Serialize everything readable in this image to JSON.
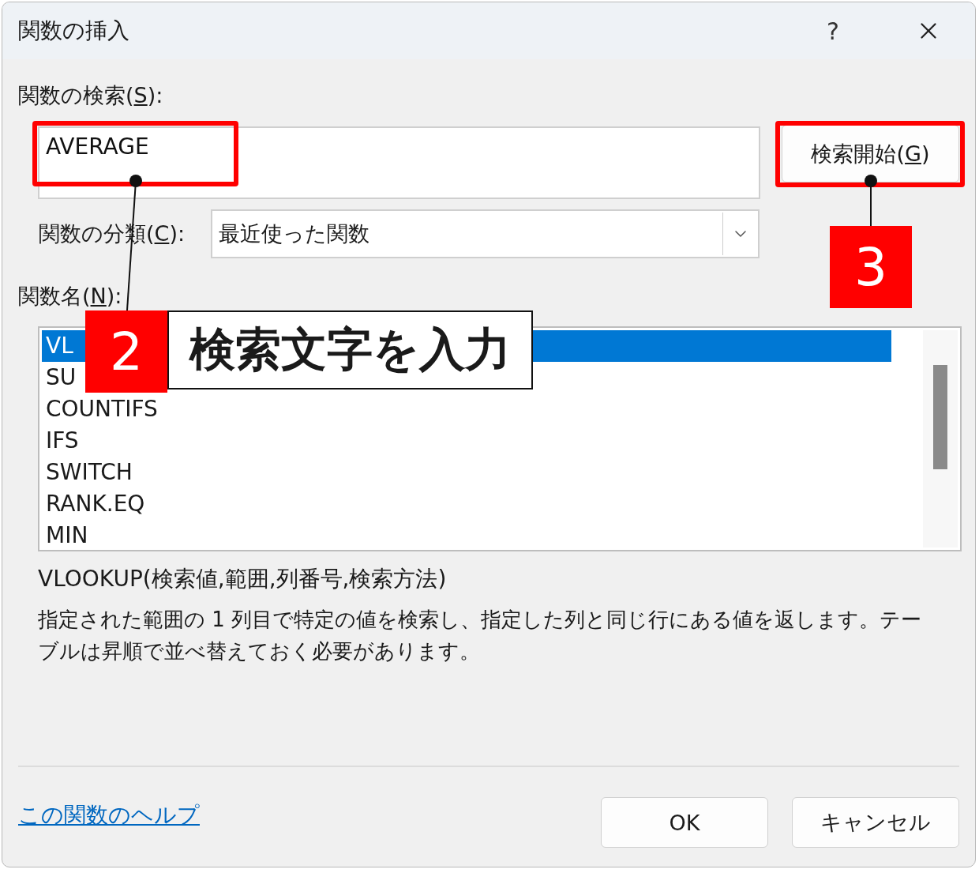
{
  "window": {
    "title": "関数の挿入",
    "help": "?"
  },
  "search": {
    "label": {
      "before": "関数の検索(",
      "key": "S",
      "after": "):"
    },
    "value": "AVERAGE",
    "highlighted": true
  },
  "search_button": {
    "label": {
      "before": "検索開始(",
      "key": "G",
      "after": ")"
    },
    "highlighted": true
  },
  "category": {
    "label": {
      "before": "関数の分類(",
      "key": "C",
      "after": "):"
    },
    "value": "最近使った関数"
  },
  "function_list": {
    "label": {
      "before": "関数名(",
      "key": "N",
      "after": "):"
    },
    "items": [
      {
        "name": "VL",
        "selected": true
      },
      {
        "name": "SU",
        "selected": false
      },
      {
        "name": "COUNTIFS",
        "selected": false
      },
      {
        "name": "IFS",
        "selected": false
      },
      {
        "name": "SWITCH",
        "selected": false
      },
      {
        "name": "RANK.EQ",
        "selected": false
      },
      {
        "name": "MIN",
        "selected": false
      }
    ]
  },
  "syntax": "VLOOKUP(検索値,範囲,列番号,検索方法)",
  "description": "指定された範囲の 1 列目で特定の値を検索し、指定した列と同じ行にある値を返します。テーブルは昇順で並べ替えておく必要があります。",
  "help_link": "この関数のヘルプ",
  "buttons": [
    "OK",
    "キャンセル"
  ],
  "callouts": [
    {
      "kind": "captioned",
      "number": "2",
      "caption": "検索文字を入力"
    },
    {
      "kind": "plain",
      "number": "3"
    }
  ]
}
